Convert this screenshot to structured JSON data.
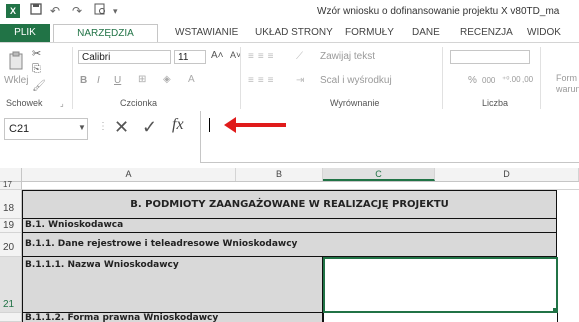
{
  "window": {
    "title": "Wzór wniosku o dofinansowanie projektu X v80TD_ma",
    "app_logo": "X",
    "app_color": "#217346"
  },
  "quick_access": {
    "icons": [
      "save-icon",
      "undo-icon",
      "redo-icon",
      "print-preview-icon",
      "customize-icon"
    ]
  },
  "tabs": [
    "PLIK",
    "NARZĘDZIA GŁÓWNE",
    "WSTAWIANIE",
    "UKŁAD STRONY",
    "FORMUŁY",
    "DANE",
    "RECENZJA",
    "WIDOK"
  ],
  "ribbon": {
    "clipboard": {
      "paste_label": "Wklej",
      "group_label": "Schowek"
    },
    "font": {
      "font_name": "Calibri",
      "font_size": "11",
      "bold": "B",
      "italic": "I",
      "underline": "U",
      "grow": "A˄",
      "shrink": "A˅",
      "group_label": "Czcionka"
    },
    "alignment": {
      "wrap_text": "Zawijaj tekst",
      "merge_center": "Scal i wyśrodkuj",
      "group_label": "Wyrównanie"
    },
    "number": {
      "percent": "%",
      "thousands": "000",
      "inc_decimal": "⁺⁰.00",
      "dec_decimal": ",00",
      "group_label": "Liczba"
    },
    "styles": {
      "format_label": "Form",
      "format_label2": "warun"
    }
  },
  "formula_bar": {
    "name_box": "C21",
    "cancel": "✕",
    "enter": "✓",
    "fx": "fx",
    "content": ""
  },
  "columns": [
    "A",
    "B",
    "C",
    "D"
  ],
  "rows": {
    "r17": "17",
    "r18": "18",
    "r19": "19",
    "r20": "20",
    "r21": "21"
  },
  "cells": {
    "section_b": "B. PODMIOTY ZAANGAŻOWANE W REALIZACJĘ PROJEKTU",
    "b1": "B.1. Wnioskodawca",
    "b11": "B.1.1. Dane rejestrowe i teleadresowe Wnioskodawcy",
    "b111": "B.1.1.1. Nazwa Wnioskodawcy",
    "b112": "B.1.1.2. Forma prawna Wnioskodawcy"
  },
  "annotation_color": "#e01b1b"
}
